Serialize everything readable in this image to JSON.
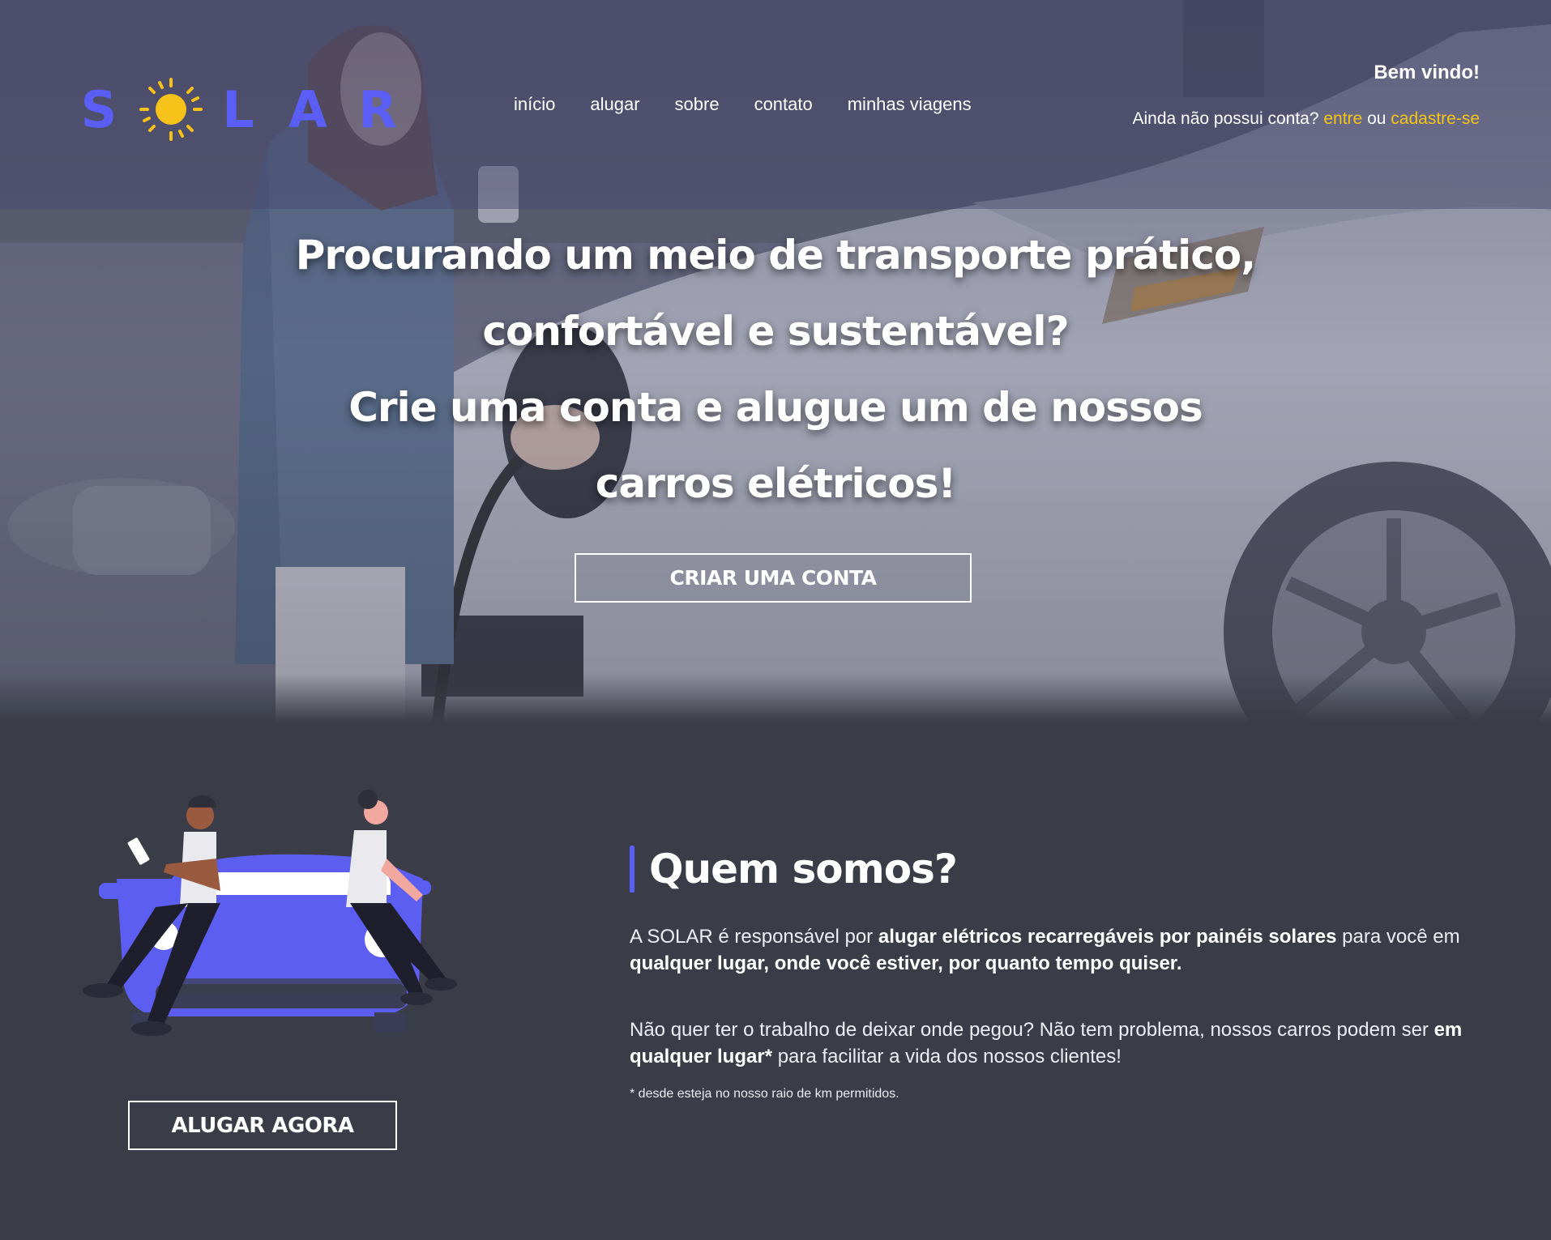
{
  "header": {
    "logo_text": [
      "S",
      "L",
      "A",
      "R"
    ],
    "nav": [
      "início",
      "alugar",
      "sobre",
      "contato",
      "minhas viagens"
    ],
    "welcome": "Bem vindo!",
    "account_prompt": "Ainda não possui conta?",
    "login_link": "entre",
    "or": "ou",
    "signup_link": "cadastre-se"
  },
  "hero": {
    "title_lines": [
      "Procurando um meio de transporte prático,",
      "confortável e sustentável?",
      "Crie uma conta e alugue um de nossos",
      "carros elétricos!"
    ],
    "cta": "CRIAR UMA CONTA"
  },
  "about": {
    "title": "Quem somos?",
    "p1_a": "A SOLAR é responsável por ",
    "p1_b": "alugar elétricos recarregáveis por painéis solares",
    "p1_c": " para você em ",
    "p1_d": "qualquer lugar, onde você estiver, por quanto tempo quiser.",
    "p2_a": "Não quer ter o trabalho de deixar onde pegou? Não tem problema, nossos carros podem ser ",
    "p2_b": "em qualquer lugar*",
    "p2_c": " para facilitar a vida dos nossos clientes!",
    "footnote": "* desde esteja no nosso raio de km permitidos.",
    "cta": "ALUGAR AGORA"
  },
  "colors": {
    "brand": "#5b5ef5",
    "accent_yellow": "#f5c518",
    "background": "#3a3d47"
  },
  "icons": [
    "sun-icon",
    "illustration-people-car"
  ]
}
